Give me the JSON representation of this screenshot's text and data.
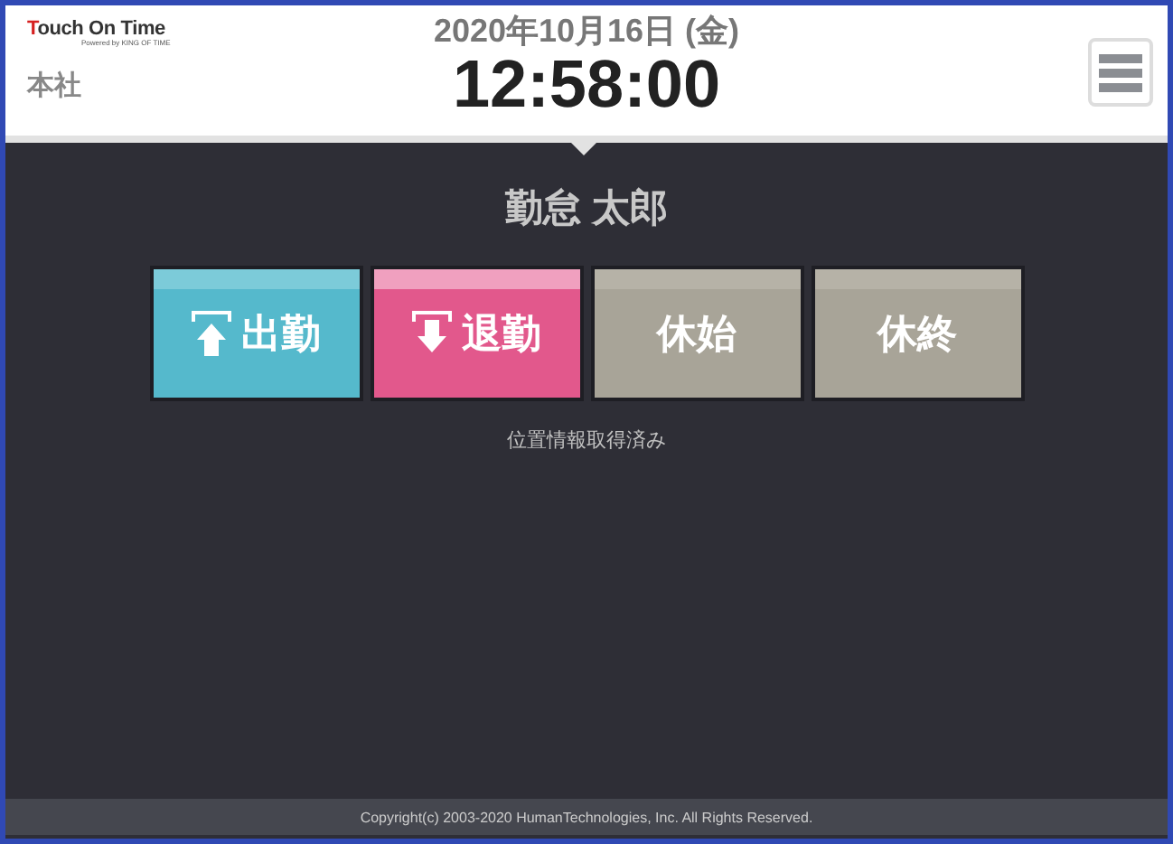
{
  "header": {
    "logo": {
      "title": "Touch On Time",
      "tagline": "Powered by KING OF TIME"
    },
    "location": "本社",
    "date": "2020年10月16日 (金)",
    "time": "12:58:00"
  },
  "employee": "勤怠 太郎",
  "punch_buttons": [
    {
      "label": "出勤",
      "kind": "clock_in"
    },
    {
      "label": "退勤",
      "kind": "clock_out"
    },
    {
      "label": "休始",
      "kind": "break_start"
    },
    {
      "label": "休終",
      "kind": "break_end"
    }
  ],
  "status": "位置情報取得済み",
  "footer": "Copyright(c) 2003-2020 HumanTechnologies, Inc. All Rights Reserved."
}
